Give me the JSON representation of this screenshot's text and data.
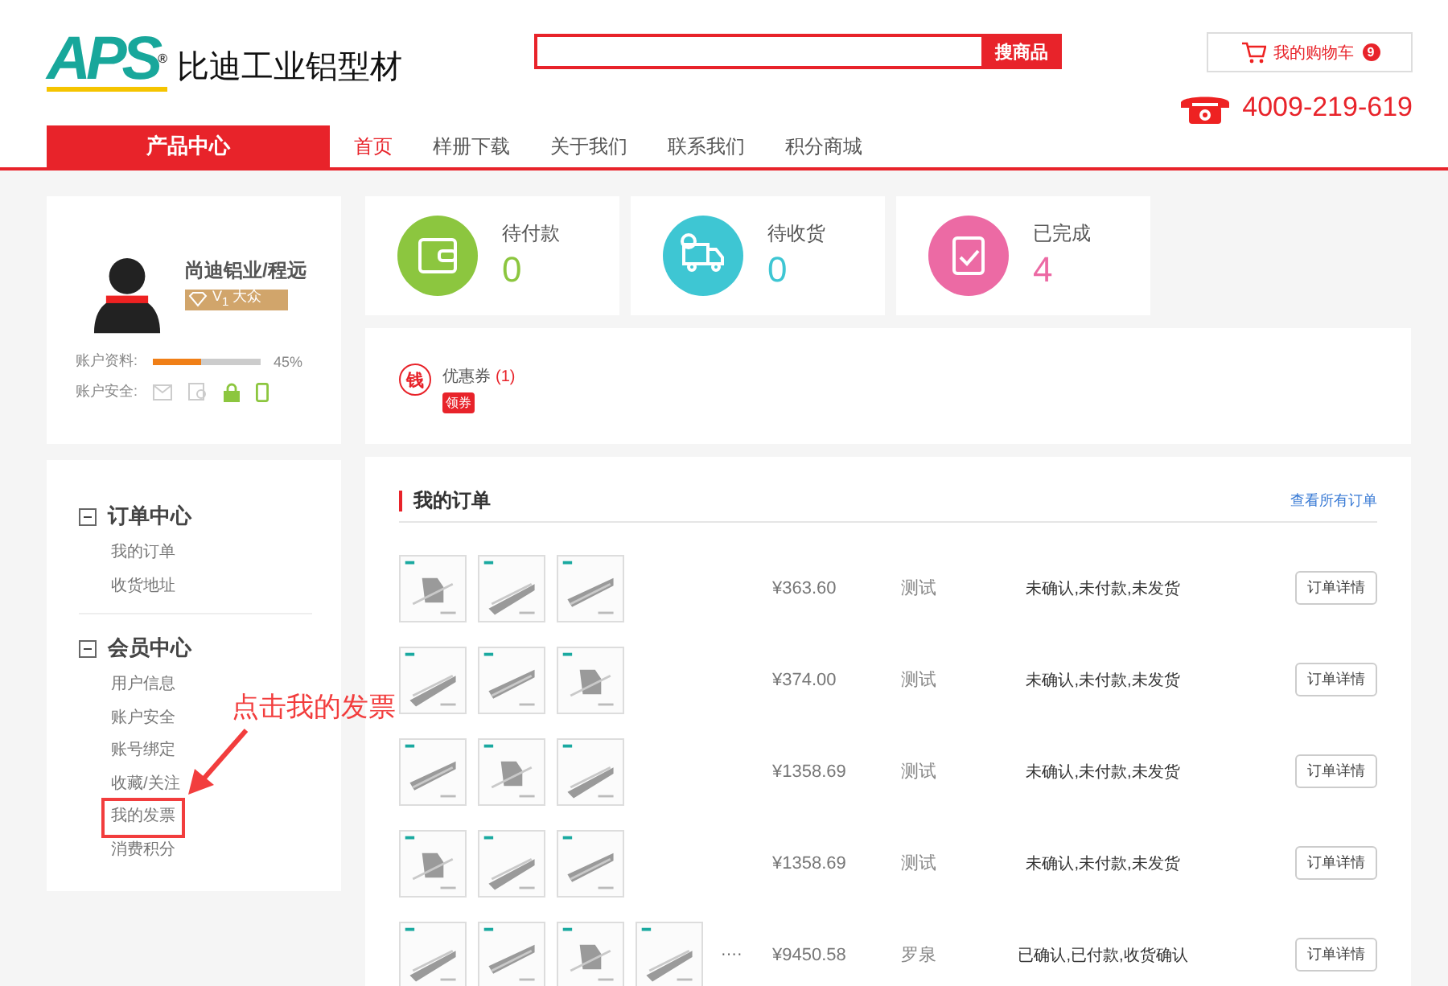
{
  "header": {
    "logo": "APS",
    "registered": "®",
    "brand": "比迪工业铝型材",
    "search": {
      "button": "搜商品"
    },
    "cart": {
      "label": "我的购物车",
      "count": "9"
    },
    "phone": "4009-219-619"
  },
  "nav": {
    "category": "产品中心",
    "items": [
      {
        "label": "首页",
        "selected": true
      },
      {
        "label": "样册下载",
        "selected": false
      },
      {
        "label": "关于我们",
        "selected": false
      },
      {
        "label": "联系我们",
        "selected": false
      },
      {
        "label": "积分商城",
        "selected": false
      }
    ]
  },
  "profile": {
    "name": "尚迪铝业/程远",
    "vip": "V$_{1}$ 大众",
    "completeness": {
      "label": "账户资料:",
      "level": 0.45,
      "reading": "45%"
    },
    "security": {
      "label": "账户安全:",
      "items": [
        {
          "kind": "email",
          "verified": false
        },
        {
          "kind": "id",
          "verified": false
        },
        {
          "kind": "lock",
          "verified": true
        },
        {
          "kind": "phone",
          "verified": true
        }
      ]
    }
  },
  "menu": [
    {
      "title": "订单中心",
      "expanded": true,
      "items": [
        {
          "label": "我的订单",
          "highlighted": false
        },
        {
          "label": "收货地址",
          "highlighted": false
        }
      ]
    },
    {
      "title": "会员中心",
      "expanded": true,
      "items": [
        {
          "label": "用户信息",
          "highlighted": false
        },
        {
          "label": "账户安全",
          "highlighted": false
        },
        {
          "label": "账号绑定",
          "highlighted": false
        },
        {
          "label": "收藏/关注",
          "highlighted": false
        },
        {
          "label": "我的发票",
          "highlighted": true
        },
        {
          "label": "消费积分",
          "highlighted": false
        }
      ]
    }
  ],
  "stats": [
    {
      "kind": "wallet",
      "label": "待付款",
      "value": "0",
      "color": "#8cc63f"
    },
    {
      "kind": "truck",
      "label": "待收货",
      "value": "0",
      "color": "#3ec6d3"
    },
    {
      "kind": "clipboard",
      "label": "已完成",
      "value": "4",
      "color": "#ec6aa4"
    }
  ],
  "coupon": {
    "icon": "钱",
    "label": "优惠券",
    "count": "(1)",
    "badge": "领券"
  },
  "orders": {
    "title": "我的订单",
    "link": "查看所有订单",
    "rows": [
      {
        "price": "¥363.60",
        "name": "测试",
        "status": "未确认,未付款,未发货",
        "button": "订单详情"
      },
      {
        "price": "¥374.00",
        "name": "测试",
        "status": "未确认,未付款,未发货",
        "button": "订单详情"
      },
      {
        "price": "¥1358.69",
        "name": "测试",
        "status": "未确认,未付款,未发货",
        "button": "订单详情"
      },
      {
        "price": "¥1358.69",
        "name": "测试",
        "status": "未确认,未付款,未发货",
        "button": "订单详情"
      },
      {
        "more": "····",
        "price": "¥9450.58",
        "name": "罗泉",
        "status": "已确认,已付款,收货确认",
        "button": "订单详情"
      }
    ]
  },
  "annotation": {
    "text": "点击我的发票"
  }
}
